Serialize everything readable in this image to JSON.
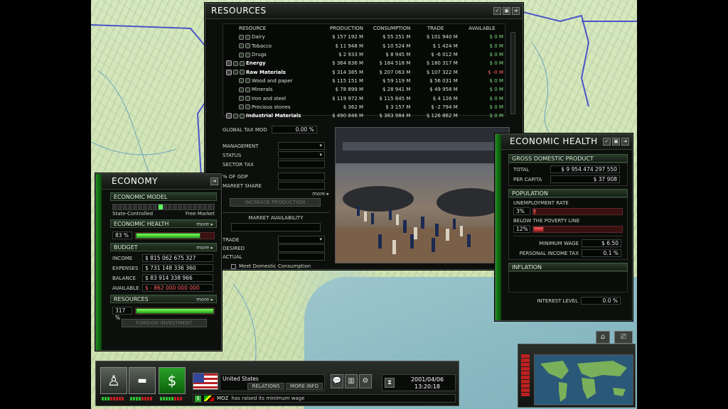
{
  "resources": {
    "title": "RESOURCES",
    "headers": [
      "RESOURCE",
      "PRODUCTION",
      "CONSUMPTION",
      "TRADE",
      "AVAILABLE"
    ],
    "rows": [
      {
        "name": "Dairy",
        "production": "$ 157 192 M",
        "consumption": "$ 55 251 M",
        "trade": "$ 101 940 M",
        "available": "$ 0 M",
        "bold": false,
        "indent": 1,
        "avail_color": "pos"
      },
      {
        "name": "Tobacco",
        "production": "$ 11 948 M",
        "consumption": "$ 10 524 M",
        "trade": "$ 1 424 M",
        "available": "$ 0 M",
        "bold": false,
        "indent": 1,
        "avail_color": "pos"
      },
      {
        "name": "Drugs",
        "production": "$ 2 933 M",
        "consumption": "$ 8 945 M",
        "trade": "$ -6 012 M",
        "available": "$ 0 M",
        "bold": false,
        "indent": 1,
        "avail_color": "pos"
      },
      {
        "name": "Energy",
        "production": "$ 364 836 M",
        "consumption": "$ 184 518 M",
        "trade": "$ 180 317 M",
        "available": "$ 0 M",
        "bold": true,
        "indent": 0,
        "avail_color": "pos"
      },
      {
        "name": "Raw Materials",
        "production": "$ 314 385 M",
        "consumption": "$ 207 063 M",
        "trade": "$ 107 322 M",
        "available": "$ -0 M",
        "bold": true,
        "indent": 0,
        "avail_color": "neg"
      },
      {
        "name": "Wood and paper",
        "production": "$ 115 151 M",
        "consumption": "$ 59 119 M",
        "trade": "$ 56 031 M",
        "available": "$ 0 M",
        "bold": false,
        "indent": 1,
        "avail_color": "pos"
      },
      {
        "name": "Minerals",
        "production": "$ 78 899 M",
        "consumption": "$ 28 941 M",
        "trade": "$ 49 958 M",
        "available": "$ 0 M",
        "bold": false,
        "indent": 1,
        "avail_color": "pos"
      },
      {
        "name": "Iron and steel",
        "production": "$ 119 972 M",
        "consumption": "$ 115 845 M",
        "trade": "$ 4 126 M",
        "available": "$ 0 M",
        "bold": false,
        "indent": 1,
        "avail_color": "pos"
      },
      {
        "name": "Precious stones",
        "production": "$ 362 M",
        "consumption": "$ 3 157 M",
        "trade": "$ -2 794 M",
        "available": "$ 0 M",
        "bold": false,
        "indent": 1,
        "avail_color": "pos"
      },
      {
        "name": "Industrial Materials",
        "production": "$ 490 846 M",
        "consumption": "$ 363 984 M",
        "trade": "$ 126 862 M",
        "available": "$ 0 M",
        "bold": true,
        "indent": 0,
        "avail_color": "pos"
      }
    ],
    "global_tax_mod_label": "GLOBAL TAX MOD",
    "global_tax_mod_value": "0.00 %",
    "management_label": "MANAGEMENT",
    "status_label": "STATUS",
    "sector_tax_label": "SECTOR TAX",
    "pct_gdp_label": "% OF GDP",
    "market_share_label": "MARKET SHARE",
    "more": "more",
    "increase_production": "INCREASE PRODUCTION",
    "market_availability": "MARKET AVAILABILITY",
    "trade_label": "TRADE",
    "desired_label": "DESIRED",
    "actual_label": "ACTUAL",
    "meet_domestic": "Meet Domestic Consumption"
  },
  "economy": {
    "title": "ECONOMY",
    "model_header": "ECONOMIC MODEL",
    "model_left": "State-Controlled",
    "model_right": "Free Market",
    "model_position": 0.45,
    "health_header": "ECONOMIC HEALTH",
    "health_value": "83 %",
    "health_fraction": 0.83,
    "more": "more",
    "budget_header": "BUDGET",
    "income_label": "INCOME",
    "income_value": "$ 815 062 675 327",
    "expenses_label": "EXPENSES",
    "expenses_value": "$ 731 148 336 360",
    "balance_label": "BALANCE",
    "balance_value": "$ 83 914 338 966",
    "available_label": "AVAILABLE",
    "available_value": "$ - 862 000 000 000",
    "resources_header": "RESOURCES",
    "resources_value": "317 %",
    "resources_fraction": 1.0,
    "foreign_investment": "FOREIGN INVESTMENT"
  },
  "health": {
    "title": "ECONOMIC HEALTH",
    "gdp_header": "GROSS DOMESTIC PRODUCT",
    "total_label": "TOTAL",
    "total_value": "$ 9 954 474 297 550",
    "per_capita_label": "PER CAPITA",
    "per_capita_value": "$ 37 908",
    "population_header": "POPULATION",
    "unemployment_label": "UNEMPLOYMENT RATE",
    "unemployment_value": "3%",
    "unemployment_fraction": 0.03,
    "poverty_label": "BELOW THE POVERTY LINE",
    "poverty_value": "12%",
    "poverty_fraction": 0.12,
    "min_wage_label": "MINIMUM WAGE",
    "min_wage_value": "$ 6.50",
    "income_tax_label": "PERSONAL INCOME TAX",
    "income_tax_value": "0.1 %",
    "inflation_header": "INFLATION",
    "interest_label": "INTEREST LEVEL",
    "interest_value": "0.0 %"
  },
  "bottom": {
    "country": "United States",
    "relations": "RELATIONS",
    "more_info": "MORE INFO",
    "date": "2001/04/06",
    "time": "13:20:18",
    "news_tag": "MOZ",
    "news_text": "has raised its minimum wage"
  },
  "colors": {
    "accent_green": "#2aa02a",
    "panel_bg": "#0c0f0c",
    "positive": "#7ce07c",
    "negative": "#ff6060"
  }
}
